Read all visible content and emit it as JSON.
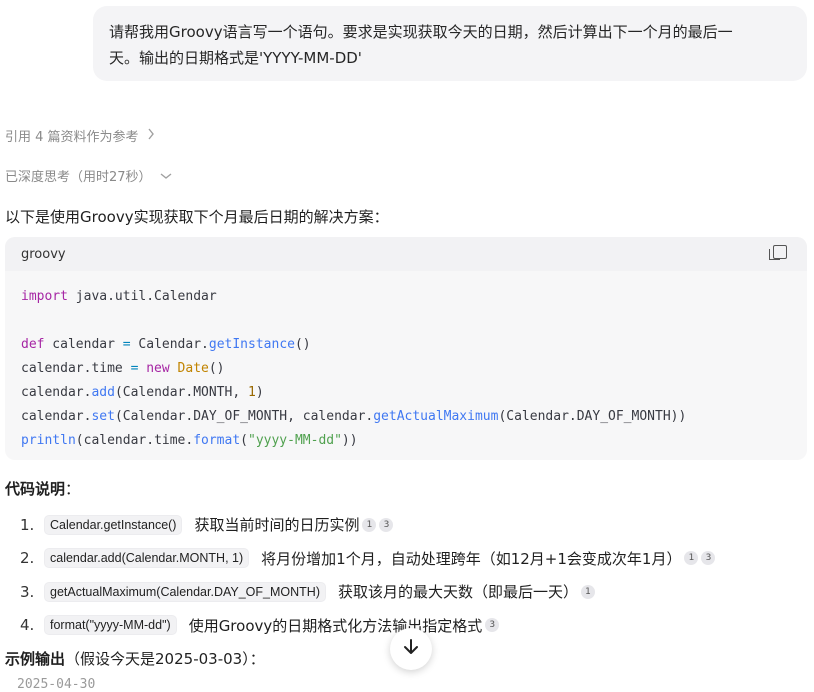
{
  "user_message": {
    "line1": "请帮我用Groovy语言写一个语句。要求是实现获取今天的日期，然后计算出下一个月的最后一",
    "line2": "天。输出的日期格式是'YYYY-MM-DD'"
  },
  "references": {
    "label": "引用 4 篇资料作为参考",
    "icon": "chevron-right-icon"
  },
  "thinking": {
    "label": "已深度思考（用时27秒）",
    "icon": "chevron-down-icon"
  },
  "intro": "以下是使用Groovy实现获取下个月最后日期的解决方案：",
  "code": {
    "language": "groovy",
    "copy_icon": "copy-icon",
    "l1_kw": "import",
    "l1_rest": " java.util.Calendar",
    "l3_kw": "def",
    "l3_a": " calendar ",
    "l3_op": "=",
    "l3_b": " Calendar.",
    "l3_fn": "getInstance",
    "l3_c": "()",
    "l4_a": "calendar.time ",
    "l4_op": "=",
    "l4_sp": " ",
    "l4_kw": "new",
    "l4_sp2": " ",
    "l4_cls": "Date",
    "l4_b": "()",
    "l5_a": "calendar.",
    "l5_fn": "add",
    "l5_b": "(Calendar.MONTH, ",
    "l5_num": "1",
    "l5_c": ")",
    "l6_a": "calendar.",
    "l6_fn": "set",
    "l6_b": "(Calendar.DAY_OF_MONTH, calendar.",
    "l6_fn2": "getActualMaximum",
    "l6_c": "(Calendar.DAY_OF_MONTH))",
    "l7_fn": "println",
    "l7_a": "(calendar.time.",
    "l7_fn2": "format",
    "l7_b": "(",
    "l7_str": "\"yyyy-MM-dd\"",
    "l7_c": "))"
  },
  "explanation": {
    "title": "代码说明",
    "colon": "：",
    "items": [
      {
        "num": "1.",
        "code": "Calendar.getInstance()",
        "text": "获取当前时间的日历实例",
        "cites": [
          "1",
          "3"
        ]
      },
      {
        "num": "2.",
        "code": "calendar.add(Calendar.MONTH, 1)",
        "text": "将月份增加1个月，自动处理跨年（如12月+1会变成次年1月）",
        "cites": [
          "1",
          "3"
        ]
      },
      {
        "num": "3.",
        "code": "getActualMaximum(Calendar.DAY_OF_MONTH)",
        "text": "获取该月的最大天数（即最后一天）",
        "cites": [
          "1"
        ]
      },
      {
        "num": "4.",
        "code": "format(\"yyyy-MM-dd\")",
        "text": "使用Groovy的日期格式化方法输出指定格式",
        "cites": [
          "3"
        ]
      }
    ]
  },
  "example": {
    "title": "示例输出",
    "note": "（假设今天是2025-03-03）：",
    "output": "2025-04-30"
  },
  "scroll_button": {
    "icon": "arrow-down-icon"
  }
}
